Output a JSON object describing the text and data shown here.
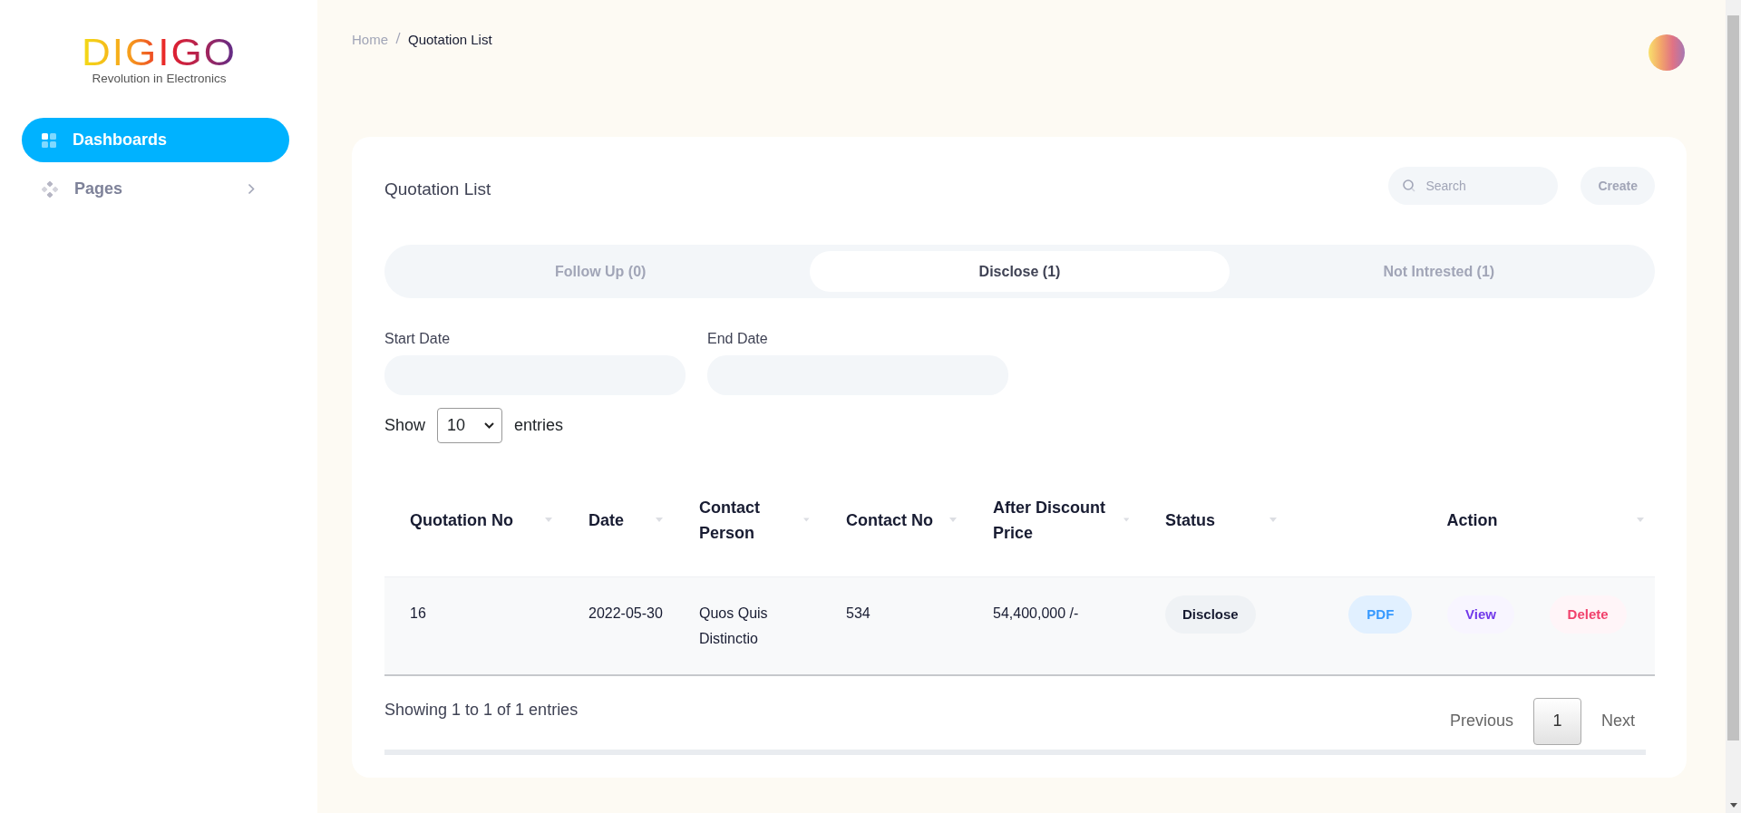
{
  "logo": {
    "wordmark": "DIGIGO",
    "tagline": "Revolution in Electronics"
  },
  "sidebar": {
    "items": [
      {
        "label": "Dashboards",
        "kind": "link",
        "selected": true
      },
      {
        "label": "Pages",
        "kind": "group",
        "selected": false
      }
    ]
  },
  "breadcrumb": [
    "Home",
    "Quotation List"
  ],
  "card": {
    "title": "Quotation List",
    "search": {
      "placeholder": "Search"
    },
    "create_button": "Create",
    "tabs": [
      {
        "label": "Follow Up (0)",
        "selected": false
      },
      {
        "label": "Disclose (1)",
        "selected": true
      },
      {
        "label": "Not Intrested (1)",
        "selected": false
      }
    ],
    "filters": [
      {
        "label": "Start Date"
      },
      {
        "label": "End Date"
      }
    ],
    "length": {
      "before": "Show",
      "value": "10",
      "after": "entries"
    },
    "table": {
      "columns": [
        "Quotation No",
        "Date",
        "Contact Person",
        "Contact No",
        "After Discount Price",
        "Status",
        "Action"
      ],
      "rows": [
        {
          "quotation_no": "16",
          "date": "2022-05-30",
          "contact_person": "Quos Quis Distinctio",
          "contact_no": "534",
          "price": "54,400,000 /-",
          "status": "Disclose",
          "actions": [
            {
              "label": "PDF",
              "kind": "pdf"
            },
            {
              "label": "View",
              "kind": "view"
            },
            {
              "label": "Delete",
              "kind": "delete"
            }
          ]
        }
      ]
    },
    "info": "Showing 1 to 1 of 1 entries",
    "pagination": {
      "previous": "Previous",
      "pages": [
        {
          "label": "1",
          "selected": true
        }
      ],
      "next": "Next"
    }
  }
}
